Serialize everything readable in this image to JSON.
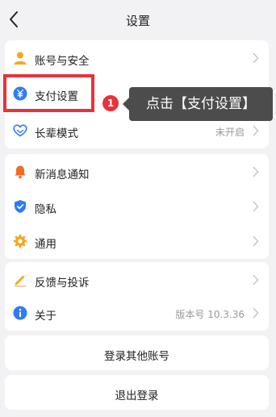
{
  "header": {
    "title": "设置"
  },
  "sections": {
    "account": {
      "items": [
        {
          "label": "账号与安全",
          "icon": "person-icon"
        },
        {
          "label": "支付设置",
          "icon": "yuan-coin-icon"
        },
        {
          "label": "长辈模式",
          "value": "未开启",
          "icon": "heart-hands-icon"
        }
      ]
    },
    "general": {
      "items": [
        {
          "label": "新消息通知",
          "icon": "bell-icon"
        },
        {
          "label": "隐私",
          "icon": "shield-icon"
        },
        {
          "label": "通用",
          "icon": "gear-icon"
        }
      ]
    },
    "about": {
      "items": [
        {
          "label": "反馈与投诉",
          "icon": "pencil-icon"
        },
        {
          "label": "关于",
          "value": "版本号 10.3.36",
          "icon": "info-icon"
        }
      ]
    }
  },
  "actions": {
    "switch_account": "登录其他账号",
    "logout": "退出登录"
  },
  "annotation": {
    "step_number": "1",
    "tooltip": "点击【支付设置】"
  },
  "colors": {
    "highlight": "#e8323b",
    "tooltip_bg": "#4c4c4c",
    "orange_icon": "#f5a623",
    "blue_icon": "#2f7bf5"
  }
}
